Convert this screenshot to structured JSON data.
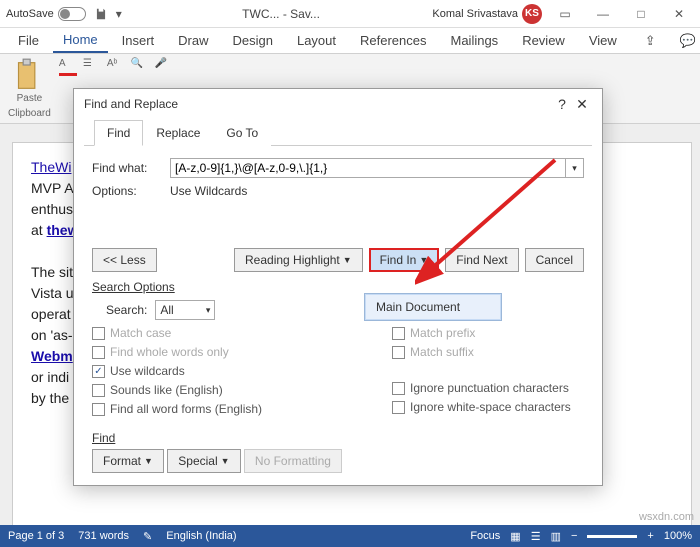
{
  "titlebar": {
    "autosave_label": "AutoSave",
    "doc_title": "TWC... - Sav...",
    "user_name": "Komal Srivastava",
    "user_initials": "KS"
  },
  "ribbon": {
    "tabs": [
      "File",
      "Home",
      "Insert",
      "Draw",
      "Design",
      "Layout",
      "References",
      "Mailings",
      "Review",
      "View"
    ],
    "paste_label": "Paste",
    "clipboard_label": "Clipboard"
  },
  "dialog": {
    "title": "Find and Replace",
    "tabs": {
      "find": "Find",
      "replace": "Replace",
      "goto": "Go To"
    },
    "find_what_label": "Find what:",
    "find_what_value": "[A-z,0-9]{1,}\\@[A-z,0-9,\\.]{1,}",
    "options_label": "Options:",
    "options_value": "Use Wildcards",
    "less_btn": "<<  Less",
    "reading_hl_btn": "Reading Highlight",
    "find_in_btn": "Find In",
    "find_next_btn": "Find Next",
    "cancel_btn": "Cancel",
    "findin_menu_item": "Main Document",
    "search_options_head": "Search Options",
    "search_label": "Search:",
    "search_value": "All",
    "cb_match_case": "Match case",
    "cb_whole_words": "Find whole words only",
    "cb_wildcards": "Use wildcards",
    "cb_sounds_like": "Sounds like (English)",
    "cb_word_forms": "Find all word forms (English)",
    "cb_prefix": "Match prefix",
    "cb_suffix": "Match suffix",
    "cb_ignore_punct": "Ignore punctuation characters",
    "cb_ignore_ws": "Ignore white-space characters",
    "find_section": "Find",
    "format_btn": "Format",
    "special_btn": "Special",
    "no_fmt_btn": "No Formatting"
  },
  "document": {
    "line1a": "TheWi",
    "line2": "MVP  A",
    "line3": "enthus",
    "line4a": "at ",
    "line4b": "thew",
    "line6": "The sit",
    "line7": "Vista u",
    "line8": "operat",
    "line9": "on 'as-",
    "line10": "Webm",
    "line11": "or indi",
    "line12": "by the"
  },
  "statusbar": {
    "page": "Page 1 of 3",
    "words": "731 words",
    "lang": "English (India)",
    "focus": "Focus",
    "zoom": "100%"
  },
  "watermark": "wsxdn.com"
}
